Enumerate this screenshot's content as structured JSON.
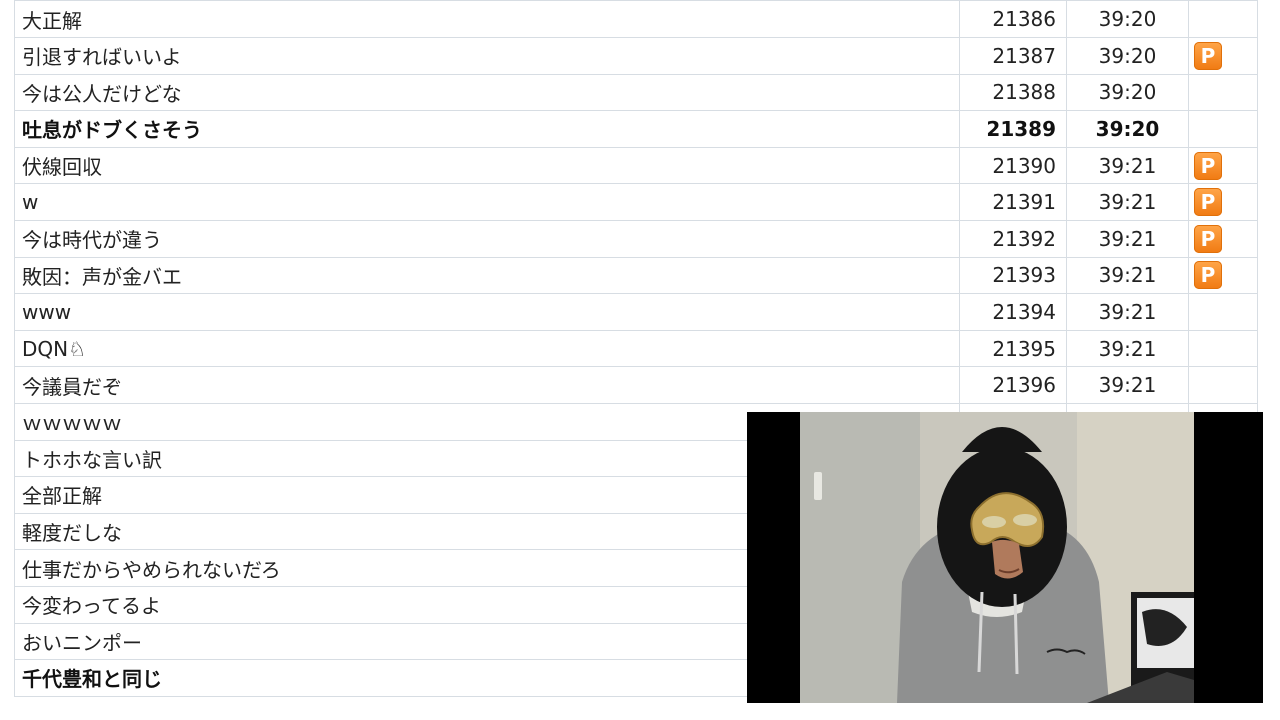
{
  "comments": [
    {
      "text": "大正解",
      "no": "21386",
      "time": "39:20",
      "premium": false,
      "bold": false
    },
    {
      "text": "引退すればいいよ",
      "no": "21387",
      "time": "39:20",
      "premium": true,
      "bold": false
    },
    {
      "text": "今は公人だけどな",
      "no": "21388",
      "time": "39:20",
      "premium": false,
      "bold": false
    },
    {
      "text": "吐息がドブくさそう",
      "no": "21389",
      "time": "39:20",
      "premium": false,
      "bold": true
    },
    {
      "text": "伏線回収",
      "no": "21390",
      "time": "39:21",
      "premium": true,
      "bold": false
    },
    {
      "text": "w",
      "no": "21391",
      "time": "39:21",
      "premium": true,
      "bold": false
    },
    {
      "text": "今は時代が違う",
      "no": "21392",
      "time": "39:21",
      "premium": true,
      "bold": false
    },
    {
      "text": "敗因：声が金バエ",
      "no": "21393",
      "time": "39:21",
      "premium": true,
      "bold": false
    },
    {
      "text": " www",
      "no": "21394",
      "time": "39:21",
      "premium": false,
      "bold": false
    },
    {
      "text": "DQN♘",
      "no": "21395",
      "time": "39:21",
      "premium": false,
      "bold": false
    },
    {
      "text": "今議員だぞ",
      "no": "21396",
      "time": "39:21",
      "premium": false,
      "bold": false
    },
    {
      "text": "ｗｗｗｗｗ",
      "no": "",
      "time": "",
      "premium": false,
      "bold": false
    },
    {
      "text": "トホホな言い訳",
      "no": "",
      "time": "",
      "premium": false,
      "bold": false
    },
    {
      "text": "全部正解",
      "no": "",
      "time": "",
      "premium": false,
      "bold": false
    },
    {
      "text": "軽度だしな",
      "no": "",
      "time": "",
      "premium": false,
      "bold": false
    },
    {
      "text": "仕事だからやめられないだろ",
      "no": "",
      "time": "",
      "premium": false,
      "bold": false
    },
    {
      "text": "今変わってるよ",
      "no": "",
      "time": "",
      "premium": false,
      "bold": false
    },
    {
      "text": "おいニンポー",
      "no": "",
      "time": "",
      "premium": false,
      "bold": false
    },
    {
      "text": "千代豊和と同じ",
      "no": "",
      "time": "",
      "premium": false,
      "bold": true
    }
  ],
  "badge_label": "P",
  "colors": {
    "grid_line": "#d7dde3",
    "premium_badge": "#f5871f",
    "video_background": "#000000"
  }
}
